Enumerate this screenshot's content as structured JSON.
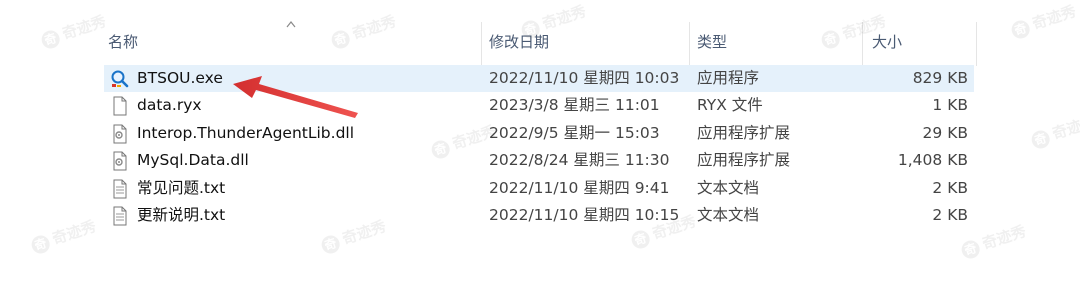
{
  "columns": {
    "name": "名称",
    "date": "修改日期",
    "type": "类型",
    "size": "大小"
  },
  "files": [
    {
      "name": "BTSOU.exe",
      "date": "2022/11/10 星期四 10:03",
      "type": "应用程序",
      "size": "829 KB",
      "icon": "search-app-icon",
      "selected": true
    },
    {
      "name": "data.ryx",
      "date": "2023/3/8 星期三 11:01",
      "type": "RYX 文件",
      "size": "1 KB",
      "icon": "blank-file-icon",
      "selected": false
    },
    {
      "name": "Interop.ThunderAgentLib.dll",
      "date": "2022/9/5 星期一 15:03",
      "type": "应用程序扩展",
      "size": "29 KB",
      "icon": "dll-file-icon",
      "selected": false
    },
    {
      "name": "MySql.Data.dll",
      "date": "2022/8/24 星期三 11:30",
      "type": "应用程序扩展",
      "size": "1,408 KB",
      "icon": "dll-file-icon",
      "selected": false
    },
    {
      "name": "常见问题.txt",
      "date": "2022/11/10 星期四 9:41",
      "type": "文本文档",
      "size": "2 KB",
      "icon": "text-file-icon",
      "selected": false
    },
    {
      "name": "更新说明.txt",
      "date": "2022/11/10 星期四 10:15",
      "type": "文本文档",
      "size": "2 KB",
      "icon": "text-file-icon",
      "selected": false
    }
  ],
  "watermark": "奇迹秀",
  "colors": {
    "selected_row": "#e5f1fb",
    "header_text": "#4a5a73",
    "annotation_arrow": "#e53935"
  }
}
